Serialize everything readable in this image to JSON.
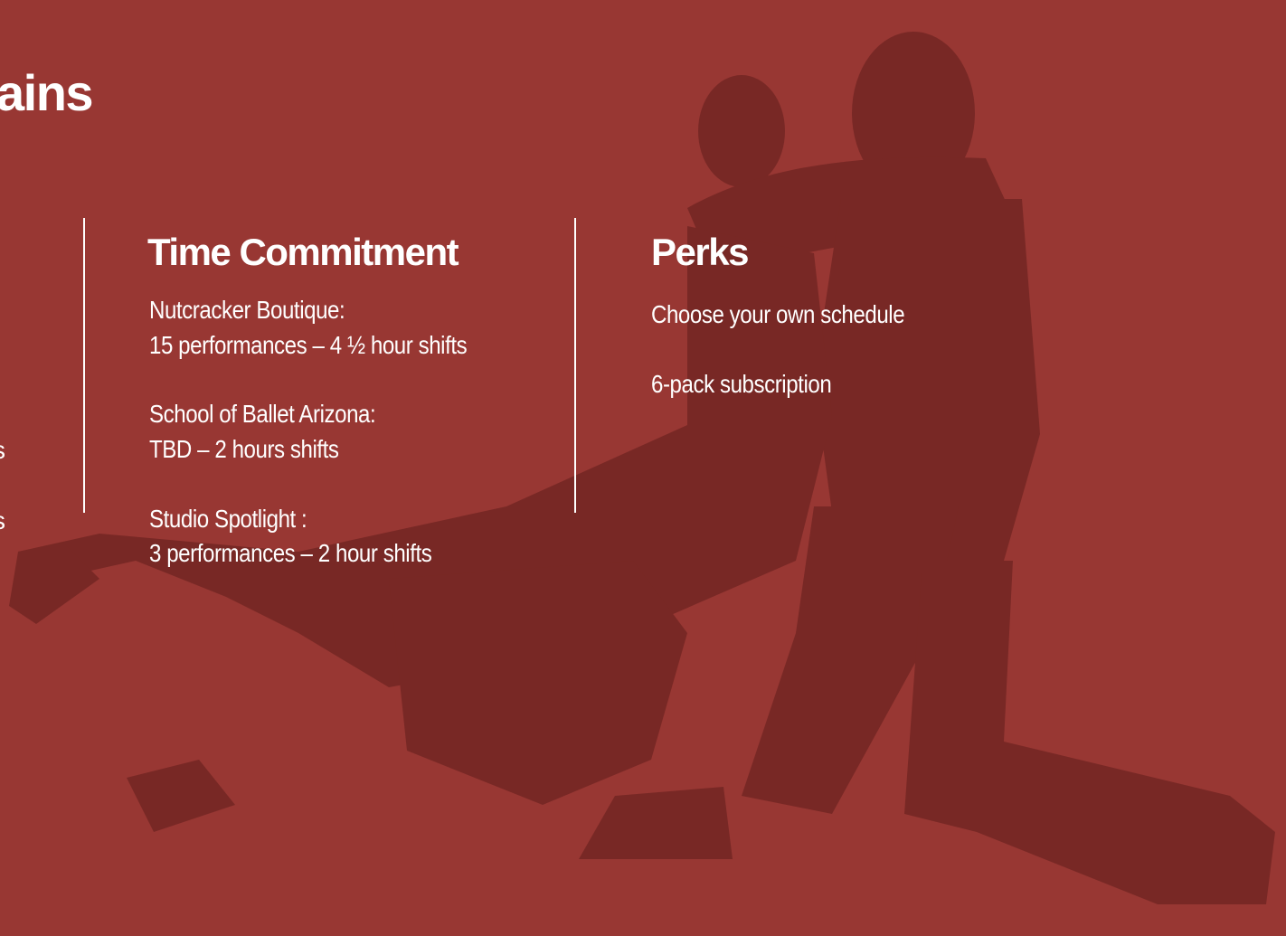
{
  "slide": {
    "title_fragment": "ains",
    "left_column_fragments": [
      "s",
      "s"
    ],
    "time_commitment": {
      "heading": "Time Commitment",
      "items": [
        {
          "label": "Nutcracker Boutique:",
          "detail": "15 performances – 4 ½ hour shifts"
        },
        {
          "label": "School of Ballet Arizona:",
          "detail": "TBD – 2 hours shifts"
        },
        {
          "label": "Studio Spotlight :",
          "detail": "3 performances – 2 hour shifts"
        }
      ]
    },
    "perks": {
      "heading": "Perks",
      "items": [
        "Choose your own schedule",
        "6-pack subscription"
      ]
    }
  },
  "colors": {
    "background": "#983733",
    "silhouette": "#6e2421",
    "text": "#ffffff"
  },
  "icons": {
    "background_photo": "dancing-couple-silhouette"
  }
}
